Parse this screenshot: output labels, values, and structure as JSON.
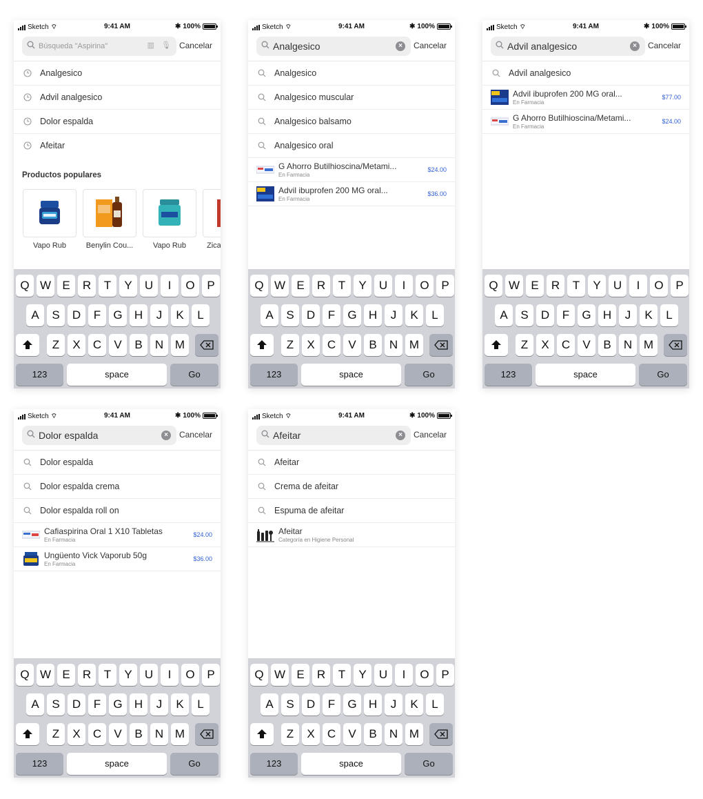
{
  "status": {
    "carrier": "Sketch",
    "time": "9:41 AM",
    "battery": "100%"
  },
  "cancel_label": "Cancelar",
  "screens": [
    {
      "search_placeholder": "Búsqueda \"Aspirina\"",
      "recent": [
        "Analgesico",
        "Advil analgesico",
        "Dolor espalda",
        "Afeitar"
      ],
      "popular_title": "Productos populares",
      "popular": [
        "Vapo Rub",
        "Benylin Cou...",
        "Vapo Rub",
        "Zica"
      ]
    },
    {
      "search_value": "Analgesico",
      "suggestions": [
        "Analgesico",
        "Analgesico muscular",
        "Analgesico balsamo",
        "Analgesico oral"
      ],
      "products": [
        {
          "name": "G Ahorro Butilhioscina/Metami...",
          "sub": "En Farmacia",
          "price": "$24.00"
        },
        {
          "name": "Advil ibuprofen 200 MG oral...",
          "sub": "En Farmacia",
          "price": "$36.00"
        }
      ]
    },
    {
      "search_value": "Advil analgesico",
      "suggestions": [
        "Advil analgesico"
      ],
      "products": [
        {
          "name": "Advil ibuprofen 200 MG oral...",
          "sub": "En Farmacia",
          "price": "$77.00"
        },
        {
          "name": "G Ahorro Butilhioscina/Metami...",
          "sub": "En Farmacia",
          "price": "$24.00"
        }
      ]
    },
    {
      "search_value": "Dolor espalda",
      "suggestions": [
        "Dolor espalda",
        "Dolor espalda crema",
        "Dolor espalda roll on"
      ],
      "products": [
        {
          "name": "Cafiaspirina Oral 1 X10 Tabletas",
          "sub": "En Farmacia",
          "price": "$24.00"
        },
        {
          "name": "Ungüento Vick Vaporub 50g",
          "sub": "En Farmacia",
          "price": "$36.00"
        }
      ]
    },
    {
      "search_value": "Afeitar",
      "suggestions": [
        "Afeitar",
        "Crema de afeitar",
        "Espuma de afeitar"
      ],
      "category": {
        "name": "Afeitar",
        "sub": "Categoría en Higiene Personal"
      }
    }
  ],
  "keyboard": {
    "row1": [
      "Q",
      "W",
      "E",
      "R",
      "T",
      "Y",
      "U",
      "I",
      "O",
      "P"
    ],
    "row2": [
      "A",
      "S",
      "D",
      "F",
      "G",
      "H",
      "J",
      "K",
      "L"
    ],
    "row3": [
      "Z",
      "X",
      "C",
      "V",
      "B",
      "N",
      "M"
    ],
    "numbers": "123",
    "space": "space",
    "go": "Go"
  },
  "colors": {
    "price": "#2f5fd0",
    "keyboard_bg": "#d1d3d9",
    "key_dark": "#acb0ba"
  }
}
